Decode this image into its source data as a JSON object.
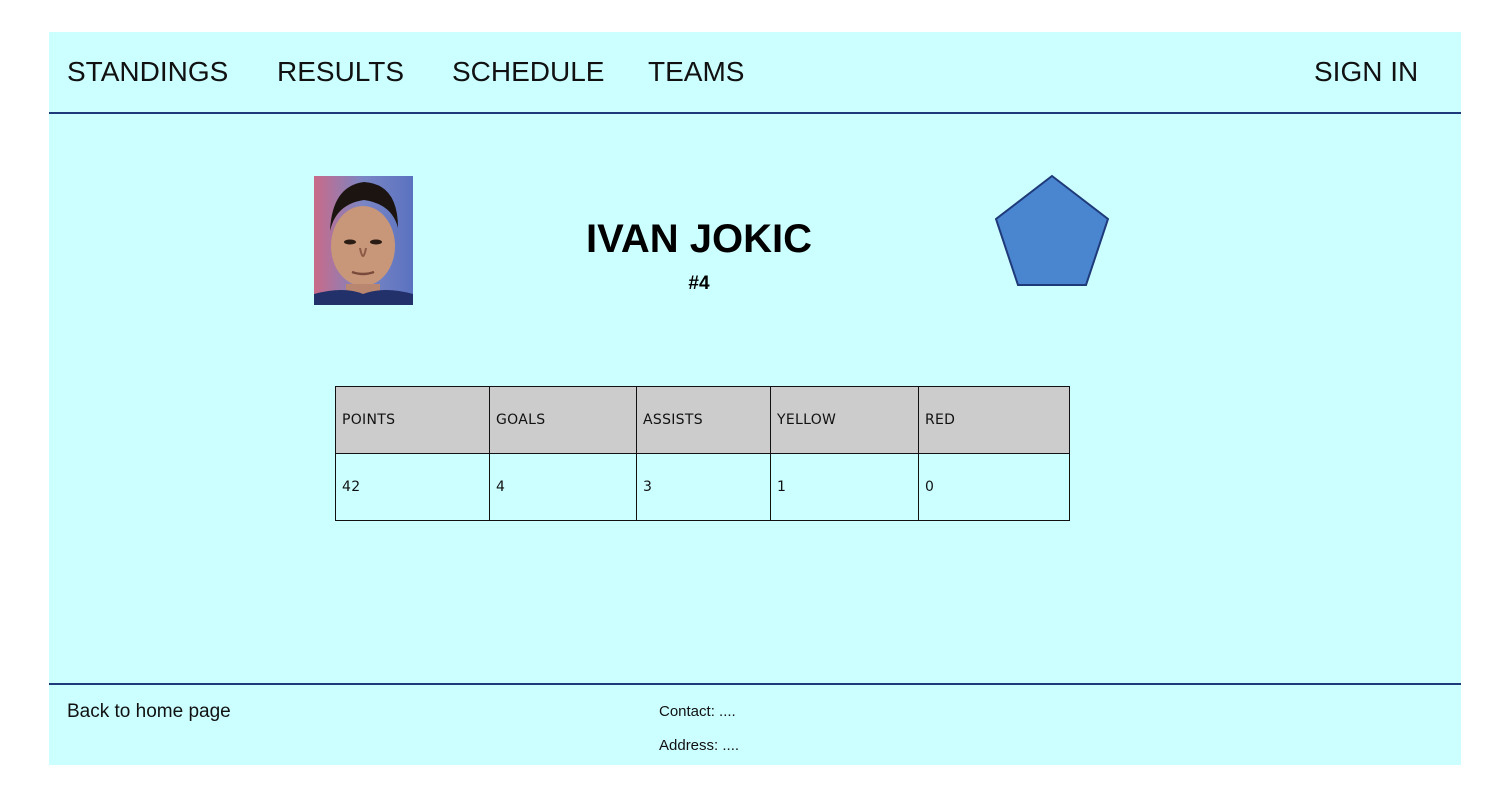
{
  "nav": {
    "standings": "STANDINGS",
    "results": "RESULTS",
    "schedule": "SCHEDULE",
    "teams": "TEAMS",
    "sign_in": "SIGN IN"
  },
  "player": {
    "name": "IVAN JOKIC",
    "number": "#4"
  },
  "stats": {
    "headers": [
      "POINTS",
      "GOALS",
      "ASSISTS",
      "YELLOW",
      "RED"
    ],
    "values": [
      "42",
      "4",
      "3",
      "1",
      "0"
    ]
  },
  "footer": {
    "back_link": "Back to home page",
    "contact": "Contact: ....",
    "address": "Address: ...."
  },
  "colors": {
    "background": "#ccffff",
    "divider": "#1f3a7a",
    "table_header": "#cccccc",
    "badge_fill": "#4a86d0",
    "badge_stroke": "#1f3a7a"
  }
}
